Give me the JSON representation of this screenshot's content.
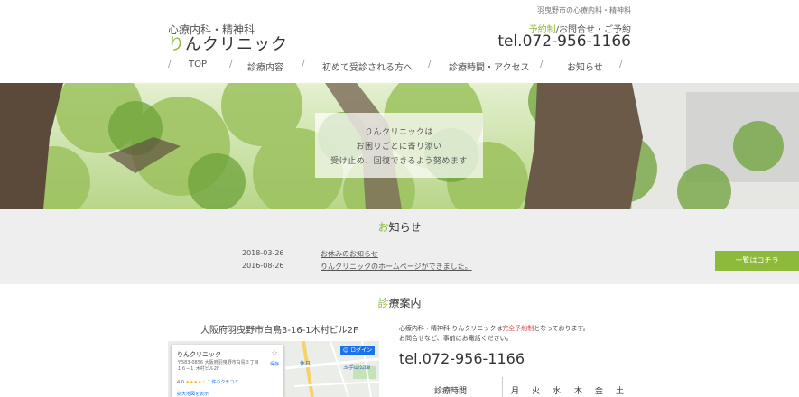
{
  "header": {
    "tagline": "羽曳野市の心療内科・精神科",
    "logo_sub": "心療内科・精神科",
    "logo_main_accent": "り",
    "logo_main_rest": "んクリニック",
    "contact_highlight": "予約制",
    "contact_rest": "/お問合せ・ご予約",
    "tel": "tel.072-956-1166"
  },
  "nav": {
    "items": [
      "TOP",
      "診療内容",
      "初めて受診される方へ",
      "診療時間・アクセス",
      "お知らせ"
    ]
  },
  "hero": {
    "lines": [
      "りんクリニックは",
      "お困りごとに寄り添い",
      "受け止め、回復できるよう努めます"
    ]
  },
  "news": {
    "title_accent": "お",
    "title_rest": "知らせ",
    "items": [
      {
        "date": "2018-03-26",
        "title": "お休みのお知らせ"
      },
      {
        "date": "2016-08-26",
        "title": "りんクリニックのホームページができました。"
      }
    ],
    "list_button": "一覧はコチラ"
  },
  "clinic": {
    "title_accent": "診",
    "title_rest": "療案内",
    "address": "大阪府羽曳野市白鳥3-16-1木村ビル2F",
    "desc_1a": "心療内科・精神科 りんクリニックは",
    "desc_1b": "完全予約制",
    "desc_1c": "となっております。",
    "desc_2": "お問合せなど、事前にお電話ください。",
    "tel": "tel.072-956-1166",
    "hours_label": "診療時間",
    "days": [
      "月",
      "火",
      "水",
      "木",
      "金",
      "土"
    ]
  },
  "map": {
    "name": "りんクリニック",
    "address": "〒583-0856 大阪府羽曳野市白鳥３丁目１６−１ 木村ビル2F",
    "rating": "4.0",
    "stars": "★★★★☆",
    "reviews": "1 件のクチコミ",
    "larger_map": "拡大地図を表示",
    "save": "保存",
    "login": "ログイン",
    "labels": [
      "休日",
      "玉手山公園"
    ]
  },
  "colors": {
    "accent": "#8dba3a",
    "news_bg": "#eeeeee",
    "red": "#d2484a"
  }
}
